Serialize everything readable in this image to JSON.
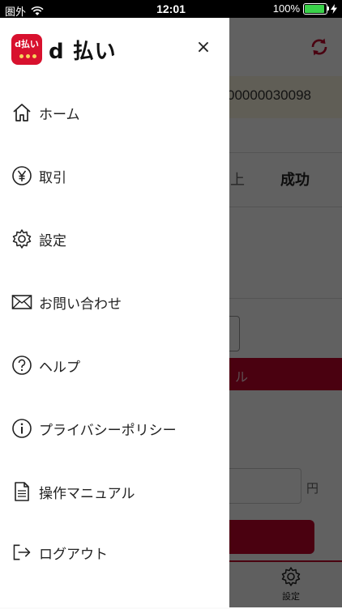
{
  "status_bar": {
    "carrier": "圏外",
    "time": "12:01",
    "battery": "100%"
  },
  "background_app": {
    "id_number": "00000030098",
    "tab_partial": "上",
    "tab_success": "成功",
    "red_bar_partial": "ル",
    "yen_unit": "円",
    "tab_settings_label": "設定"
  },
  "drawer": {
    "logo_badge_text": "d払い",
    "logo_text": "d 払い",
    "close_icon": "×",
    "items": [
      {
        "label": "ホーム",
        "icon": "home-icon"
      },
      {
        "label": "取引",
        "icon": "yen-icon"
      },
      {
        "label": "設定",
        "icon": "gear-icon"
      },
      {
        "label": "お問い合わせ",
        "icon": "mail-icon"
      },
      {
        "label": "ヘルプ",
        "icon": "help-icon"
      },
      {
        "label": "プライバシーポリシー",
        "icon": "info-icon"
      },
      {
        "label": "操作マニュアル",
        "icon": "document-icon"
      },
      {
        "label": "ログアウト",
        "icon": "logout-icon"
      }
    ]
  },
  "colors": {
    "brand_red": "#c2042b",
    "logo_red": "#d8112e",
    "overlay": "rgba(0,0,0,0.62)"
  }
}
